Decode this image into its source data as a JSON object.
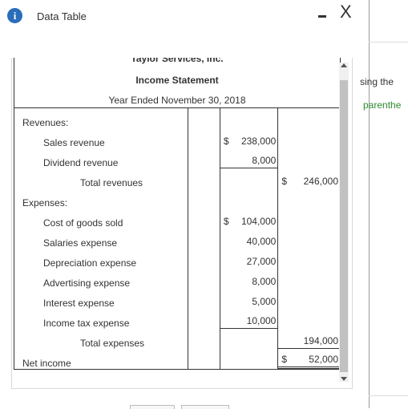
{
  "dialog": {
    "title": "Data Table",
    "info_icon": "info-icon",
    "minimize_icon": "minimize-icon",
    "close_icon": "close-icon",
    "close_glyph": "X"
  },
  "statement": {
    "company": "Taylor Services, Inc.",
    "name": "Income Statement",
    "period": "Year Ended November 30, 2018",
    "revenues_label": "Revenues:",
    "revenues": [
      {
        "label": "Sales revenue",
        "currency": "$",
        "amount": "238,000"
      },
      {
        "label": "Dividend revenue",
        "currency": "",
        "amount": "8,000"
      }
    ],
    "total_revenues": {
      "label": "Total revenues",
      "currency": "$",
      "amount": "246,000"
    },
    "expenses_label": "Expenses:",
    "expenses": [
      {
        "label": "Cost of goods sold",
        "currency": "$",
        "amount": "104,000"
      },
      {
        "label": "Salaries expense",
        "currency": "",
        "amount": "40,000"
      },
      {
        "label": "Depreciation expense",
        "currency": "",
        "amount": "27,000"
      },
      {
        "label": "Advertising expense",
        "currency": "",
        "amount": "8,000"
      },
      {
        "label": "Interest expense",
        "currency": "",
        "amount": "5,000"
      },
      {
        "label": "Income tax expense",
        "currency": "",
        "amount": "10,000"
      }
    ],
    "total_expenses": {
      "label": "Total expenses",
      "currency": "",
      "amount": "194,000"
    },
    "net_income": {
      "label": "Net income",
      "currency": "$",
      "amount": "52,000"
    }
  },
  "background": {
    "text1": "sing the",
    "text2": "parenthe",
    "text2_color": "#2e8b2e"
  }
}
